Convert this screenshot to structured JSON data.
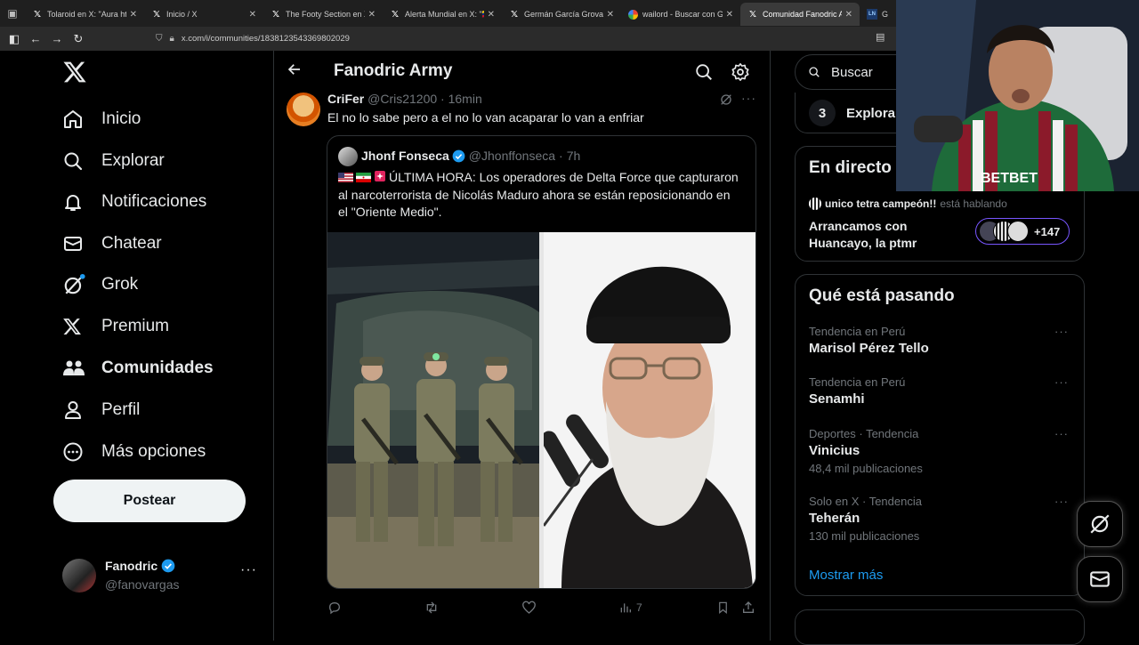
{
  "browser": {
    "tabs": [
      {
        "title": "Tolaroid en X: \"Aura https:/",
        "favicon": "x",
        "active": false
      },
      {
        "title": "Inicio / X",
        "favicon": "x",
        "active": false
      },
      {
        "title": "The Footy Section en X: \"Th",
        "favicon": "x",
        "active": false
      },
      {
        "title": "Alerta Mundial en X: \"🇻🇪 | Ú",
        "favicon": "x",
        "active": false
      },
      {
        "title": "Germán García Grova en X: ",
        "favicon": "x",
        "active": false
      },
      {
        "title": "wailord - Buscar con Googl",
        "favicon": "google",
        "active": false
      },
      {
        "title": "Comunidad Fanodric Army",
        "favicon": "x",
        "active": true
      },
      {
        "title": "Giro",
        "favicon": "doc",
        "active": false
      }
    ],
    "close_glyph": "✕",
    "url": "x.com/i/communities/1838123543369802029"
  },
  "sidebar": {
    "items": [
      {
        "label": "Inicio",
        "icon": "home-icon",
        "bold": false
      },
      {
        "label": "Explorar",
        "icon": "search-icon",
        "bold": false
      },
      {
        "label": "Notificaciones",
        "icon": "bell-icon",
        "bold": false
      },
      {
        "label": "Chatear",
        "icon": "mail-icon",
        "bold": false
      },
      {
        "label": "Grok",
        "icon": "grok-icon",
        "bold": false
      },
      {
        "label": "Premium",
        "icon": "x-logo-icon",
        "bold": false
      },
      {
        "label": "Comunidades",
        "icon": "communities-icon",
        "bold": true
      },
      {
        "label": "Perfil",
        "icon": "person-icon",
        "bold": false
      },
      {
        "label": "Más opciones",
        "icon": "more-circle-icon",
        "bold": false
      }
    ],
    "post_button": "Postear",
    "account": {
      "name": "Fanodric",
      "handle": "@fanovargas",
      "more": "···"
    }
  },
  "main": {
    "title": "Fanodric Army",
    "post": {
      "name": "CriFer",
      "handle": "@Cris21200",
      "sep": "·",
      "time": "16min",
      "text": "El no lo sabe pero a el no lo van acaparar lo van a enfriar",
      "more": "···"
    },
    "quote": {
      "name": "Jhonf Fonseca",
      "handle": "@Jhonffonseca",
      "sep": "·",
      "time": "7h",
      "text_line1": "ÚLTIMA HORA: Los operadores de Delta Force que capturaron",
      "text_line2": "al narcoterrorista de Nicolás Maduro ahora se están reposicionando en",
      "text_line3": "el \"Oriente Medio\"."
    },
    "actions": {
      "views": "7"
    }
  },
  "right": {
    "search_placeholder": "Buscar",
    "explore_item": {
      "num": "3",
      "label": "Explora y"
    },
    "live": {
      "title": "En directo",
      "host": "unico tetra campeón!!",
      "status": "está hablando",
      "space_title": "Arrancamos con Huancayo, la ptmr",
      "listeners": "+147"
    },
    "trends": {
      "title": "Qué está pasando",
      "items": [
        {
          "context": "Tendencia en Perú",
          "name": "Marisol Pérez Tello",
          "count": ""
        },
        {
          "context": "Tendencia en Perú",
          "name": "Senamhi",
          "count": ""
        },
        {
          "context": "Deportes · Tendencia",
          "name": "Vinicius",
          "count": "48,4 mil publicaciones"
        },
        {
          "context": "Solo en X · Tendencia",
          "name": "Teherán",
          "count": "130 mil publicaciones"
        }
      ],
      "more_glyph": "···",
      "show_more": "Mostrar más"
    }
  },
  "webcam": {
    "shirt_text": "BETBET"
  },
  "colors": {
    "accent": "#1d9bf0",
    "verified": "#1d9bf0",
    "grok_dot": "#1d9bf0",
    "space_border": "#7856ff"
  }
}
